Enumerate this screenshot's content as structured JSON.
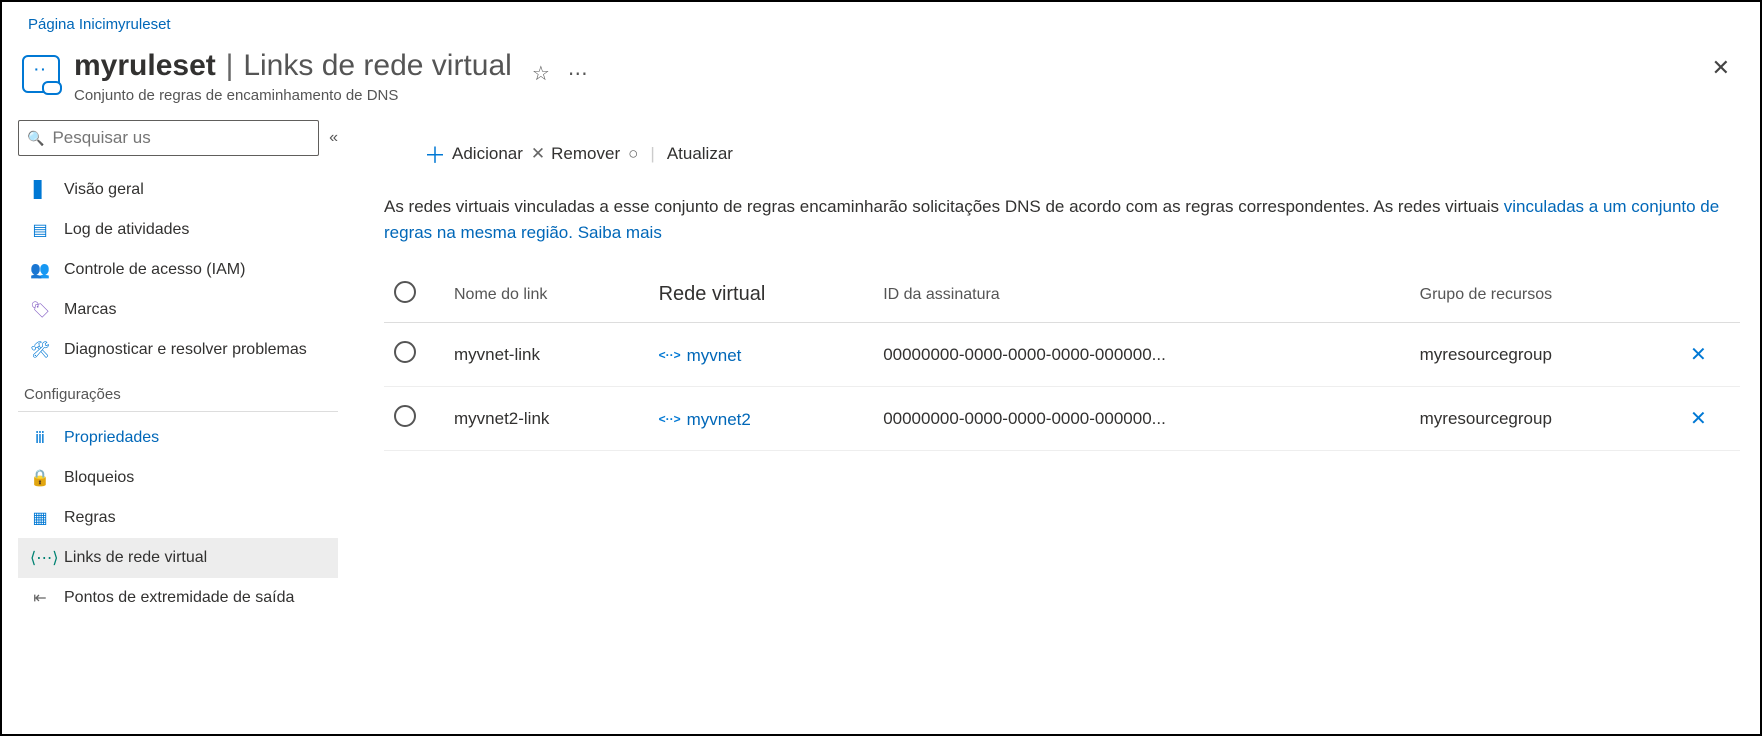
{
  "breadcrumb": {
    "home": "Página Inici",
    "resource": "myruleset"
  },
  "header": {
    "title": "myruleset",
    "separator": "|",
    "page_subtitle": "Links de rede virtual",
    "resource_type": "Conjunto de regras de encaminhamento de DNS",
    "resource_icon_glyph": "‹··›"
  },
  "sidebar": {
    "search_placeholder": "Pesquisar us",
    "items": {
      "overview": "Visão geral",
      "activity_log": "Log de atividades",
      "iam": "Controle de acesso (IAM)",
      "tags": "Marcas",
      "diagnose": "Diagnosticar e resolver problemas"
    },
    "section_settings": "Configurações",
    "settings": {
      "properties": "Propriedades",
      "locks": "Bloqueios",
      "rules": "Regras",
      "vnet_links": "Links de rede virtual",
      "outbound_endpoints": "Pontos de extremidade de saída"
    }
  },
  "toolbar": {
    "add": "Adicionar",
    "remove": "Remover",
    "refresh": "Atualizar"
  },
  "description": {
    "text": "As redes virtuais vinculadas a esse conjunto de regras encaminharão solicitações DNS de acordo com as regras correspondentes. As redes virtuais ",
    "link1": "vinculadas a um conjunto de regras na mesma região.",
    "link2": "Saiba mais"
  },
  "table": {
    "headers": {
      "link_name": "Nome do link",
      "vnet": "Rede virtual",
      "subscription_id": "ID da assinatura",
      "resource_group": "Grupo de recursos"
    },
    "rows": [
      {
        "link_name": "myvnet-link",
        "vnet": "myvnet",
        "subscription_id": "00000000-0000-0000-0000-000000...",
        "resource_group": "myresourcegroup"
      },
      {
        "link_name": "myvnet2-link",
        "vnet": "myvnet2",
        "subscription_id": "00000000-0000-0000-0000-000000...",
        "resource_group": "myresourcegroup"
      }
    ]
  }
}
